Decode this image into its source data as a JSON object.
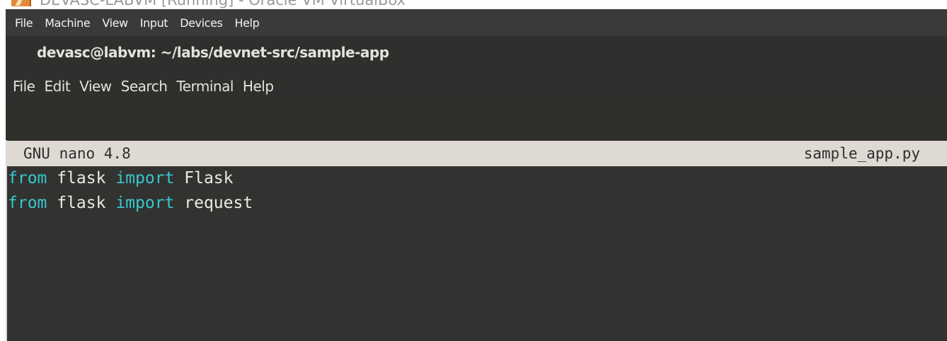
{
  "window": {
    "title": "DEVASC-LABVM [Running] - Oracle VM VirtualBox"
  },
  "vbox_menu": {
    "items": [
      "File",
      "Machine",
      "View",
      "Input",
      "Devices",
      "Help"
    ]
  },
  "terminal": {
    "title": "devasc@labvm: ~/labs/devnet-src/sample-app",
    "menu": [
      "File",
      "Edit",
      "View",
      "Search",
      "Terminal",
      "Help"
    ]
  },
  "nano": {
    "version": "GNU nano 4.8",
    "filename": "sample_app.py",
    "lines": [
      {
        "kw1": "from",
        "mod": " flask ",
        "kw2": "import",
        "name": " Flask"
      },
      {
        "kw1": "from",
        "mod": " flask ",
        "kw2": "import",
        "name": " request"
      }
    ]
  },
  "colors": {
    "keyword": "#35c8cf",
    "text": "#ece9e3",
    "header_bg": "#ded9d3",
    "terminal_bg": "#323230"
  }
}
